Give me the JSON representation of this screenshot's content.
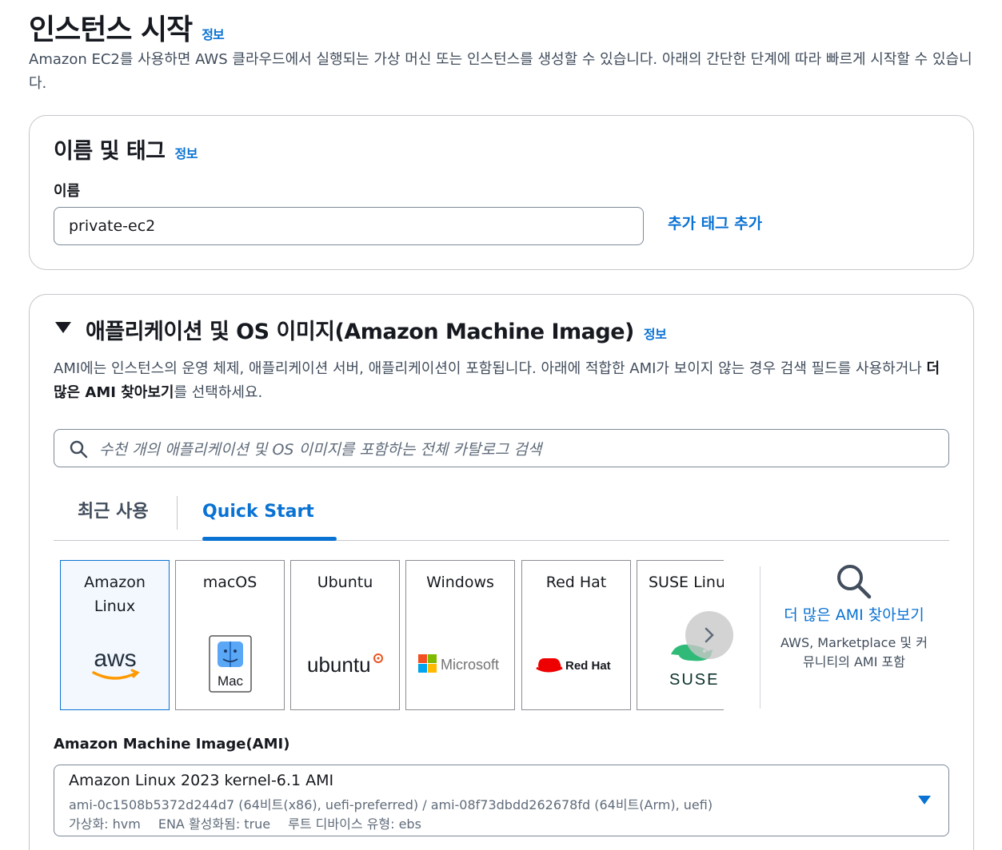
{
  "page": {
    "title": "인스턴스 시작",
    "info": "정보",
    "description": "Amazon EC2를 사용하면 AWS 클라우드에서 실행되는 가상 머신 또는 인스턴스를 생성할 수 있습니다. 아래의 간단한 단계에 따라 빠르게 시작할 수 있습니다."
  },
  "name_tags": {
    "title": "이름 및 태그",
    "info": "정보",
    "name_label": "이름",
    "name_value": "private-ec2",
    "add_tag": "추가 태그 추가"
  },
  "ami_section": {
    "title": "애플리케이션 및 OS 이미지(Amazon Machine Image)",
    "info": "정보",
    "desc_part1": "AMI에는 인스턴스의 운영 체제, 애플리케이션 서버, 애플리케이션이 포함됩니다. 아래에 적합한 AMI가 보이지 않는 경우 검색 필드를 사용하거나 ",
    "desc_bold": "더 많은 AMI 찾아보기",
    "desc_part2": "를 선택하세요.",
    "search_placeholder": "수천 개의 애플리케이션 및 OS 이미지를 포함하는 전체 카탈로그 검색",
    "tabs": {
      "recent": "최근 사용",
      "quick_start": "Quick Start"
    },
    "cards": [
      {
        "label": "Amazon Linux",
        "logo_text": "aws"
      },
      {
        "label": "macOS",
        "logo_text": "Mac"
      },
      {
        "label": "Ubuntu",
        "logo_text": "ubuntu"
      },
      {
        "label": "Windows",
        "logo_text": "Microsoft"
      },
      {
        "label": "Red Hat",
        "logo_text": "Red Hat"
      },
      {
        "label": "SUSE Linux",
        "logo_text": "SUSE"
      }
    ],
    "more": {
      "link": "더 많은 AMI 찾아보기",
      "sub": "AWS, Marketplace 및 커뮤니티의 AMI 포함"
    },
    "ami_label": "Amazon Machine Image(AMI)",
    "ami_selected": {
      "name": "Amazon Linux 2023 kernel-6.1 AMI",
      "ids": "ami-0c1508b5372d244d7 (64비트(x86), uefi-preferred) / ami-08f73dbdd262678fd (64비트(Arm), uefi)",
      "virtualization": "가상화: hvm",
      "ena": "ENA 활성화됨: true",
      "root_device": "루트 디바이스 유형: ebs"
    }
  },
  "colors": {
    "accent": "#0972d3",
    "text": "#16191f",
    "muted": "#414d5c",
    "border": "#7d8998"
  },
  "icons": [
    "search-icon",
    "chevron-right-icon",
    "caret-down-icon",
    "triangle-down-icon"
  ]
}
